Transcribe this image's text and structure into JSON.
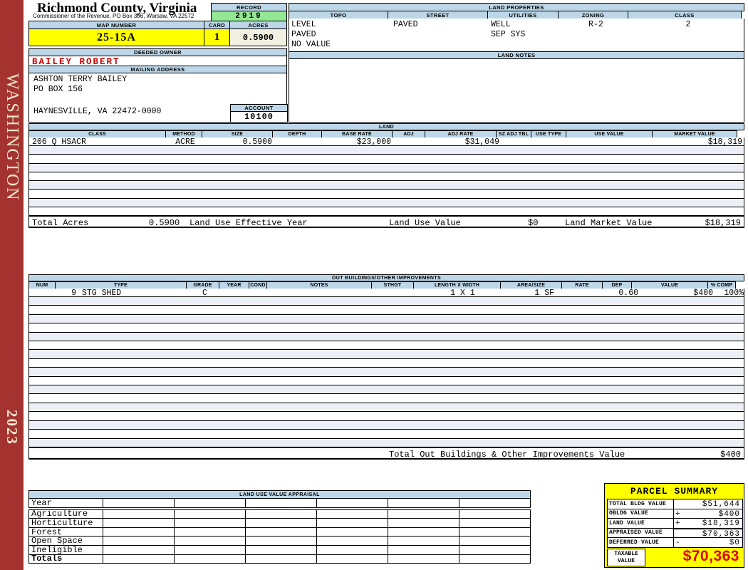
{
  "sidebar": {
    "district": "WASHINGTON",
    "year": "2023"
  },
  "header": {
    "county": "Richmond County, Virginia",
    "office": "Commissioner of the Revenue, PO Box 366, Warsaw, VA 22572",
    "record_label": "RECORD",
    "record_value": "2919",
    "map_label": "MAP NUMBER",
    "map_value": "25-15A",
    "card_label": "CARD",
    "card_value": "1",
    "acres_label": "ACRES",
    "acres_value": "0.5900"
  },
  "owner": {
    "deeded_label": "DEEDED OWNER",
    "name": "BAILEY ROBERT",
    "mailing_label": "MAILING ADDRESS",
    "address_line1": "ASHTON TERRY BAILEY",
    "address_line2": "PO BOX 156",
    "address_line3": "HAYNESVILLE, VA 22472-0000",
    "account_label": "ACCOUNT",
    "account_value": "10100"
  },
  "land_properties": {
    "title": "LAND PROPERTIES",
    "columns": [
      "TOPO",
      "STREET",
      "UTILITIES",
      "ZONING",
      "CLASS"
    ],
    "topo": [
      "LEVEL",
      "PAVED",
      "NO VALUE"
    ],
    "street": [
      "PAVED"
    ],
    "utilities": [
      "WELL",
      "SEP SYS"
    ],
    "zoning": "R-2",
    "class": "2",
    "notes_title": "LAND NOTES"
  },
  "land": {
    "title": "LAND",
    "columns": [
      "CLASS",
      "METHOD",
      "SIZE",
      "DEPTH",
      "BASE RATE",
      "ADJ",
      "ADJ RATE",
      "SZ ADJ TBL",
      "USE TYPE",
      "USE VALUE",
      "MARKET VALUE"
    ],
    "row": {
      "class": "206 Q HSACR",
      "method": "ACRE",
      "size": "0.5900",
      "base_rate": "$23,000",
      "adj_rate": "$31,049",
      "market_value": "$18,319"
    },
    "totals": {
      "total_acres_label": "Total Acres",
      "total_acres": "0.5900",
      "effective_year_label": "Land Use Effective Year",
      "use_value_label": "Land Use Value",
      "use_value": "$0",
      "market_value_label": "Land Market Value",
      "market_value": "$18,319"
    }
  },
  "out_buildings": {
    "title": "OUT BUILDINGS/OTHER IMPROVEMENTS",
    "columns": [
      "NUM",
      "TYPE",
      "GRADE",
      "YEAR",
      "COND",
      "NOTES",
      "STHGT",
      "LENGTH X WIDTH",
      "AREA/SIZE",
      "RATE",
      "DEP",
      "VALUE",
      "% COMP"
    ],
    "row": {
      "num": "9",
      "type": "STG SHED",
      "grade": "C",
      "length_width": "1 X 1",
      "area": "1 SF",
      "dep": "0.60",
      "value": "$400",
      "pct_comp": "100%"
    },
    "total_label": "Total Out Buildings & Other Improvements Value",
    "total_value": "$400"
  },
  "land_use_appraisal": {
    "title": "LAND USE VALUE APPRAISAL",
    "row_labels": [
      "Year",
      "Agriculture",
      "Horticulture",
      "Forest",
      "Open Space",
      "Ineligible",
      "Totals"
    ]
  },
  "parcel_summary": {
    "title": "PARCEL SUMMARY",
    "rows": [
      {
        "label": "TOTAL BLDG VALUE",
        "op": "",
        "value": "$51,644"
      },
      {
        "label": "OBLDG VALUE",
        "op": "+",
        "value": "$400"
      },
      {
        "label": "LAND VALUE",
        "op": "+",
        "value": "$18,319"
      },
      {
        "label": "APPRAISED VALUE",
        "op": "",
        "value": "$70,363"
      },
      {
        "label": "DEFERRED VALUE",
        "op": "-",
        "value": "$0"
      }
    ],
    "taxable_label": "TAXABLE VALUE",
    "taxable_value": "$70,363"
  },
  "colors": {
    "sidebar_red": "#A43330",
    "header_blue": "#BDD7E8",
    "record_green": "#94E894",
    "highlight_yellow": "#FFFF00",
    "owner_red": "#CC0000",
    "taxable_red": "#DD0000"
  }
}
